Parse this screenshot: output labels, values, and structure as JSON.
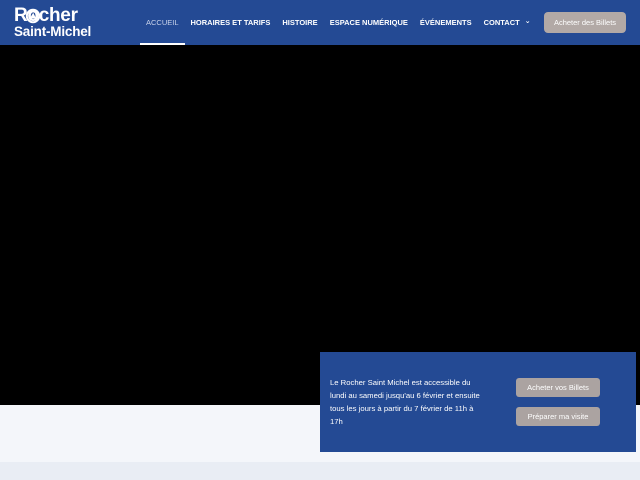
{
  "brand": {
    "line1": "Rocher",
    "line2": "Saint-Michel"
  },
  "nav": {
    "items": [
      {
        "label": "ACCUEIL",
        "active": true
      },
      {
        "label": "HORAIRES ET TARIFS",
        "active": false
      },
      {
        "label": "HISTOIRE",
        "active": false
      },
      {
        "label": "ESPACE NUMÉRIQUE",
        "active": false
      },
      {
        "label": "ÉVÉNEMENTS",
        "active": false
      },
      {
        "label": "CONTACT",
        "active": false,
        "icon": "chevron-down-icon"
      }
    ]
  },
  "header": {
    "cta_label": "Acheter des Billets"
  },
  "info_panel": {
    "text": "Le Rocher Saint Michel est accessible du lundi au samedi jusqu'au 6 février et ensuite tous les jours à partir du 7 février de 11h à 17h",
    "buy_label": "Acheter vos Billets",
    "visit_label": "Préparer ma visite"
  },
  "colors": {
    "header_bg": "#244a94",
    "button_bg": "#b2a9a6",
    "video_bg": "#000000",
    "page_bg": "#f4f6fa"
  }
}
